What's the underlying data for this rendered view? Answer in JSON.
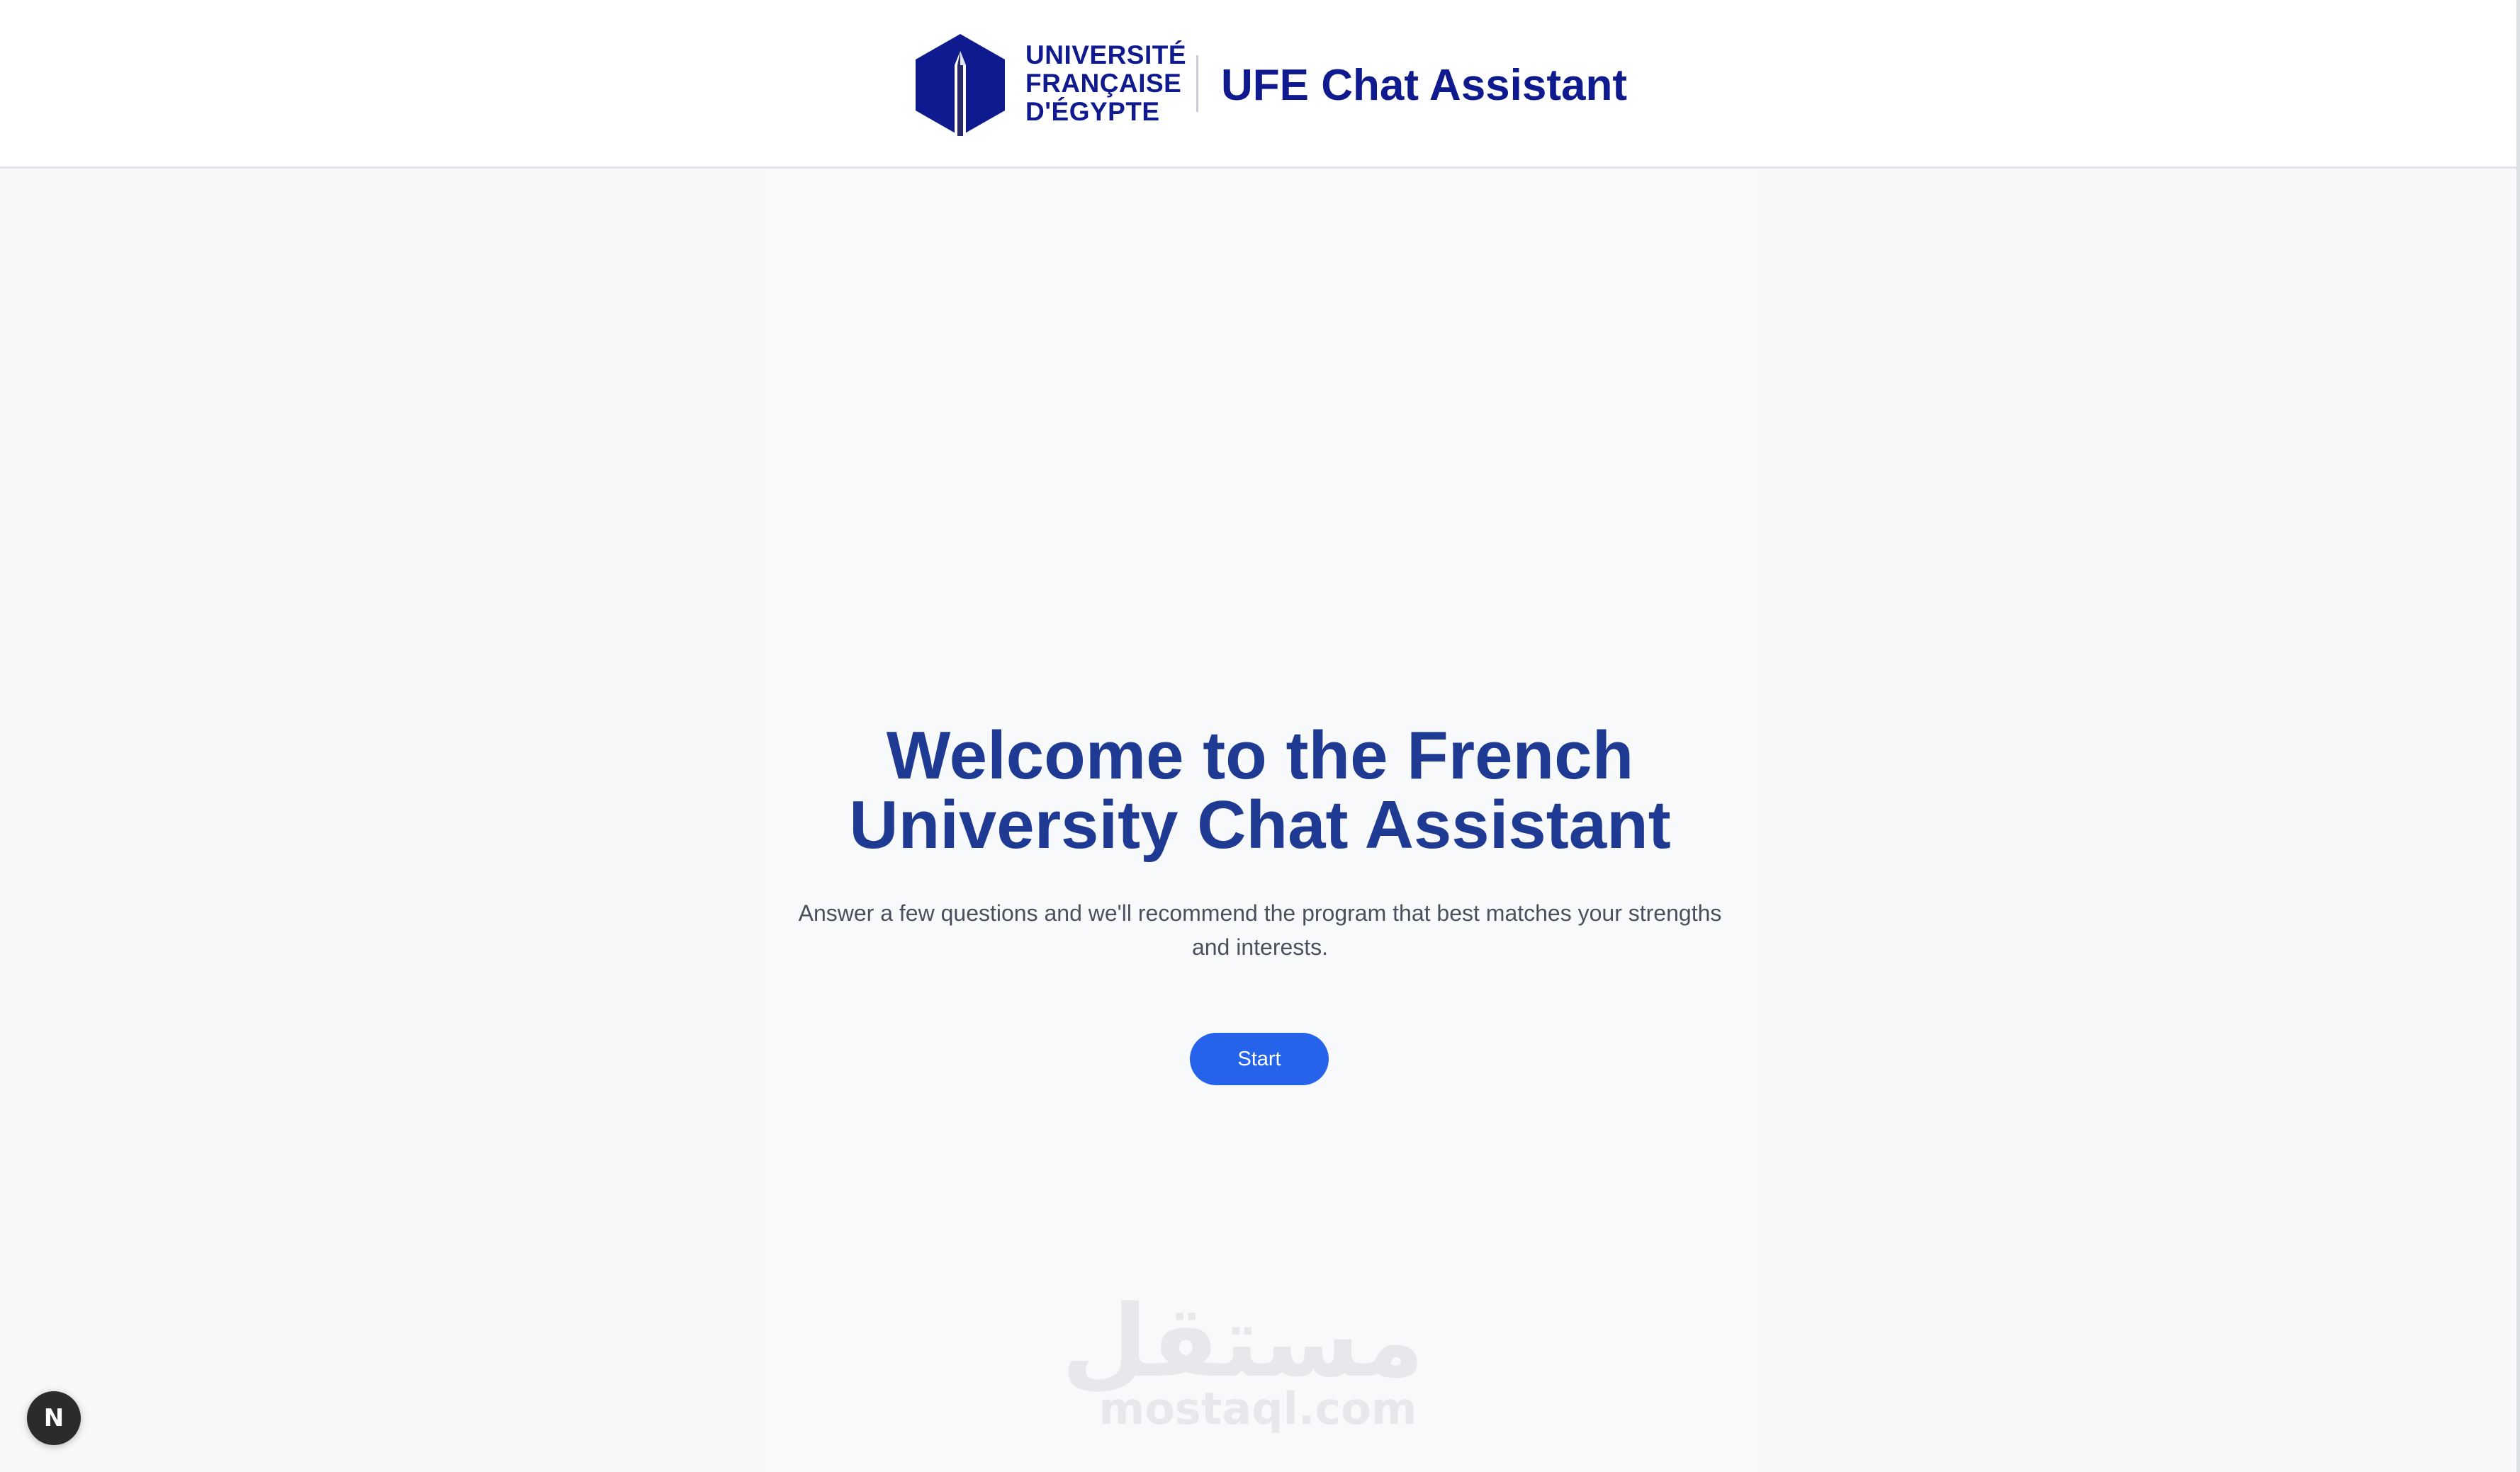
{
  "header": {
    "logo": {
      "lines": [
        "UNIVERSITÉ",
        "FRANÇAISE",
        "D'ÉGYPTE"
      ],
      "icon": "obelisk-hexagon-icon",
      "brand_color": "#0f1a8f"
    },
    "app_title": "UFE Chat Assistant"
  },
  "welcome": {
    "title": "Welcome to the French University Chat Assistant",
    "subtitle": "Answer a few questions and we'll recommend the program that best matches your strengths and interests.",
    "start_label": "Start",
    "title_color": "#1f3a93",
    "button_color": "#2563eb"
  },
  "watermark": {
    "arabic": "مستقل",
    "latin": "mostaql.com"
  },
  "dev_badge": {
    "label": "N",
    "icon": "nextjs-icon"
  }
}
